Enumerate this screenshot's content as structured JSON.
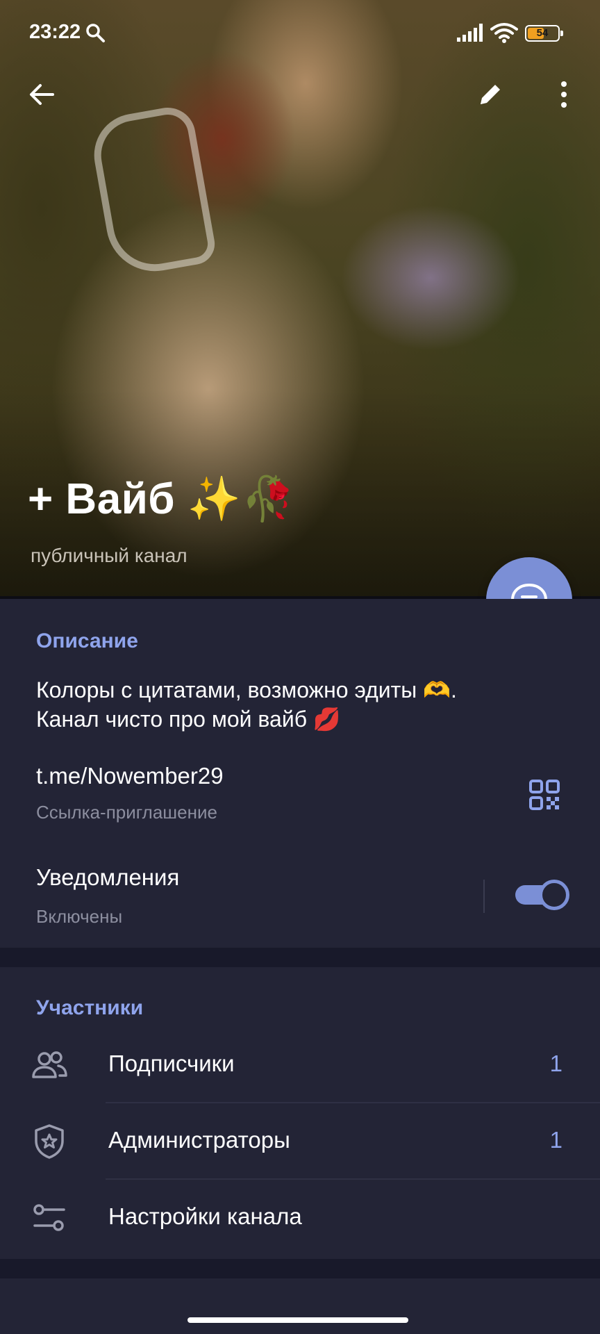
{
  "status_bar": {
    "time": "23:22",
    "battery_percent": "54",
    "icons": [
      "search-icon",
      "signal-icon",
      "wifi-icon",
      "battery-icon"
    ]
  },
  "toolbar": {
    "icons": [
      "back-arrow-icon",
      "edit-pencil-icon",
      "more-vertical-icon"
    ]
  },
  "channel": {
    "title": "+ Вайб ✨🥀",
    "subtitle": "публичный канал"
  },
  "fab": {
    "icon": "chat-bubble-icon"
  },
  "info": {
    "header": "Описание",
    "description_line1": "Колоры с цитатами, возможно эдиты 🫶.",
    "description_line2": "Канал чисто про мой вайб 💋",
    "link": "t.me/Nowember29",
    "link_caption": "Ссылка-приглашение",
    "notifications_title": "Уведомления",
    "notifications_caption": "Включены",
    "notifications_on": true
  },
  "members": {
    "header": "Участники",
    "rows": [
      {
        "label": "Подписчики",
        "count": "1",
        "icon": "people-icon"
      },
      {
        "label": "Администраторы",
        "count": "1",
        "icon": "shield-star-icon"
      },
      {
        "label": "Настройки канала",
        "count": "",
        "icon": "sliders-icon"
      }
    ]
  },
  "colors": {
    "accent": "#8fa4ec",
    "fab": "#7b8fd6",
    "section_bg": "#232436",
    "gap_bg": "#18192a",
    "secondary_text": "#8c8e9f"
  }
}
